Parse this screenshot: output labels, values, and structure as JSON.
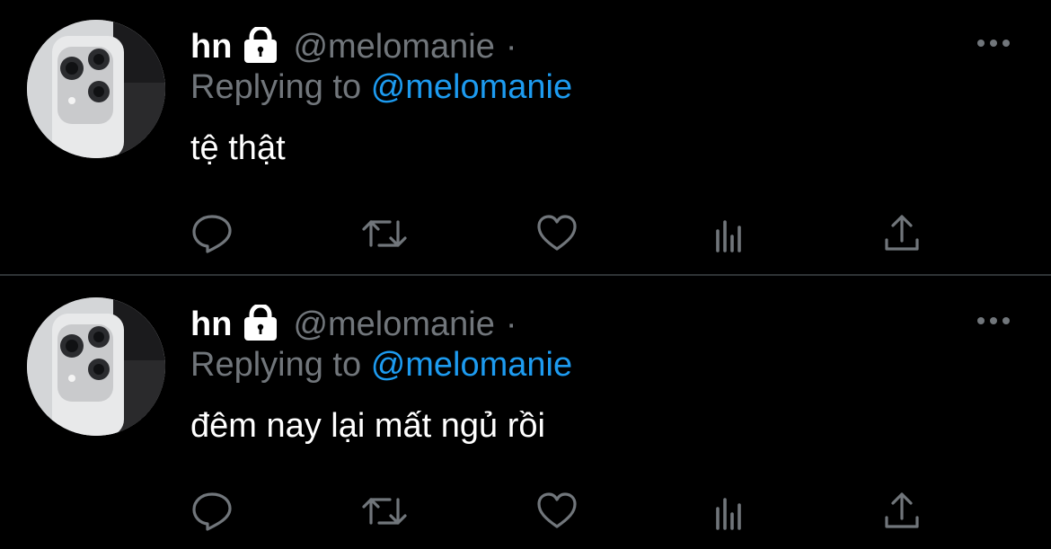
{
  "colors": {
    "background": "#000000",
    "divider": "#2f3336",
    "name": "#ffffff",
    "muted": "#71767b",
    "mention": "#1d9bf0",
    "text": "#ffffff"
  },
  "tweets": [
    {
      "author_name": "hn",
      "handle": "@melomanie",
      "separator": "·",
      "replying_prefix": "Replying to",
      "replying_to": "@melomanie",
      "text": "tệ thật",
      "icons": [
        "lock-icon",
        "more-icon",
        "reply-icon",
        "retweet-icon",
        "like-icon",
        "views-icon",
        "share-icon"
      ]
    },
    {
      "author_name": "hn",
      "handle": "@melomanie",
      "separator": "·",
      "replying_prefix": "Replying to",
      "replying_to": "@melomanie",
      "text": "đêm nay lại mất ngủ rồi",
      "icons": [
        "lock-icon",
        "more-icon",
        "reply-icon",
        "retweet-icon",
        "like-icon",
        "views-icon",
        "share-icon"
      ]
    }
  ]
}
